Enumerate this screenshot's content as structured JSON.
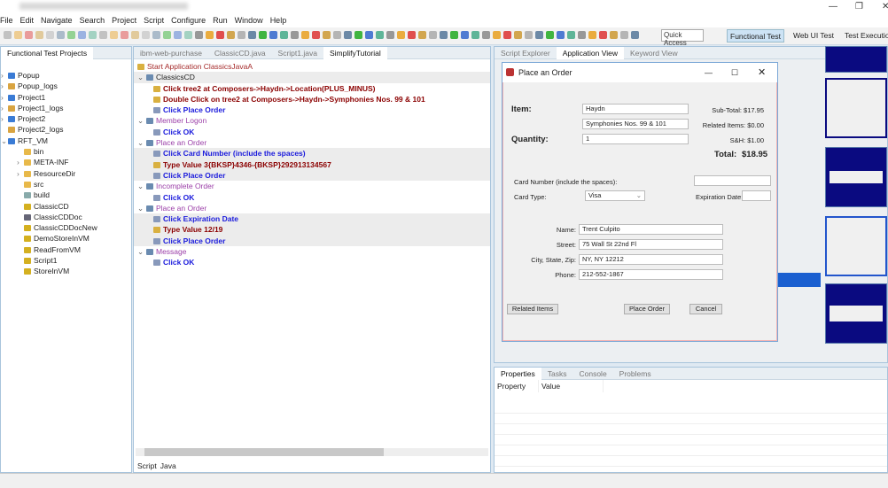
{
  "window": {
    "controls": [
      "—",
      "❐",
      "✕"
    ]
  },
  "menu": [
    "File",
    "Edit",
    "Navigate",
    "Search",
    "Project",
    "Script",
    "Configure",
    "Run",
    "Window",
    "Help"
  ],
  "toolbar": {
    "quick_access": "Quick Access",
    "perspectives": [
      "Functional Test",
      "Web UI Test",
      "Test Execution"
    ]
  },
  "projects": {
    "title": "Functional Test Projects",
    "items": [
      {
        "label": "Popup",
        "type": "project",
        "level": 0,
        "expander": "›"
      },
      {
        "label": "Popup_logs",
        "type": "logs",
        "level": 0,
        "expander": "›"
      },
      {
        "label": "Project1",
        "type": "project",
        "level": 0,
        "expander": "›"
      },
      {
        "label": "Project1_logs",
        "type": "logs",
        "level": 0,
        "expander": "›"
      },
      {
        "label": "Project2",
        "type": "project",
        "level": 0,
        "expander": "›"
      },
      {
        "label": "Project2_logs",
        "type": "logs",
        "level": 0,
        "expander": ""
      },
      {
        "label": "RFT_VM",
        "type": "project",
        "level": 0,
        "expander": "⌄"
      },
      {
        "label": "bin",
        "type": "folder",
        "level": 1,
        "expander": ""
      },
      {
        "label": "META-INF",
        "type": "folder",
        "level": 1,
        "expander": "›"
      },
      {
        "label": "ResourceDir",
        "type": "folder",
        "level": 1,
        "expander": "›"
      },
      {
        "label": "src",
        "type": "folder",
        "level": 1,
        "expander": ""
      },
      {
        "label": "build",
        "type": "file",
        "level": 1,
        "expander": ""
      },
      {
        "label": "ClassicCD",
        "type": "script",
        "level": 1,
        "expander": ""
      },
      {
        "label": "ClassicCDDoc",
        "type": "doc",
        "level": 1,
        "expander": ""
      },
      {
        "label": "ClassicCDDocNew",
        "type": "script",
        "level": 1,
        "expander": ""
      },
      {
        "label": "DemoStoreInVM",
        "type": "script",
        "level": 1,
        "expander": ""
      },
      {
        "label": "ReadFromVM",
        "type": "script",
        "level": 1,
        "expander": ""
      },
      {
        "label": "Script1",
        "type": "script",
        "level": 1,
        "expander": ""
      },
      {
        "label": "StoreInVM",
        "type": "script",
        "level": 1,
        "expander": ""
      }
    ]
  },
  "editor": {
    "tabs": [
      "ibm-web-purchase",
      "ClassicCD.java",
      "Script1.java",
      "SimplifyTutorial"
    ],
    "active_tab": 3,
    "steps": [
      {
        "text": "Start  Application  ClassicsJavaA",
        "style": "start",
        "level": 0,
        "hl": false
      },
      {
        "text": "ClassicsCD",
        "style": "group",
        "level": 0,
        "hl": true
      },
      {
        "text": "Click  tree2  at  Composers->Haydn->Location(PLUS_MINUS)",
        "style": "red",
        "level": 1,
        "hl": false
      },
      {
        "text": "Double  Click  on  tree2  at  Composers->Haydn->Symphonies Nos. 99 & 101",
        "style": "red",
        "level": 1,
        "hl": false
      },
      {
        "text": "Click  Place Order",
        "style": "blue",
        "level": 1,
        "hl": false
      },
      {
        "text": "Member Logon",
        "style": "purple",
        "level": 0,
        "hl": false
      },
      {
        "text": "Click  OK",
        "style": "blue",
        "level": 1,
        "hl": false
      },
      {
        "text": "Place an Order",
        "style": "purple",
        "level": 0,
        "hl": false
      },
      {
        "text": "Click  Card Number (include the spaces)",
        "style": "blue",
        "level": 1,
        "hl": true
      },
      {
        "text": "Type  Value  3{BKSP}4346-{BKSP}292913134567",
        "style": "red",
        "level": 1,
        "hl": true
      },
      {
        "text": "Click  Place Order",
        "style": "blue",
        "level": 1,
        "hl": true
      },
      {
        "text": "Incomplete Order",
        "style": "purple",
        "level": 0,
        "hl": false
      },
      {
        "text": "Click  OK",
        "style": "blue",
        "level": 1,
        "hl": false
      },
      {
        "text": "Place an Order",
        "style": "purple",
        "level": 0,
        "hl": false
      },
      {
        "text": "Click  Expiration Date",
        "style": "blue",
        "level": 1,
        "hl": true
      },
      {
        "text": "Type  Value  12/19",
        "style": "red",
        "level": 1,
        "hl": true
      },
      {
        "text": "Click  Place Order",
        "style": "blue",
        "level": 1,
        "hl": true
      },
      {
        "text": "Message",
        "style": "purple",
        "level": 0,
        "hl": false
      },
      {
        "text": "Click  OK",
        "style": "blue",
        "level": 1,
        "hl": false
      }
    ],
    "bottom_tabs": [
      "Script",
      "Java"
    ]
  },
  "right_tabs": {
    "tabs": [
      "Script Explorer",
      "Application View",
      "Keyword View"
    ],
    "active_tab": 1
  },
  "dialog": {
    "title": "Place an Order",
    "item_label": "Item:",
    "item1": "Haydn",
    "item2": "Symphonies Nos. 99 & 101",
    "quantity_label": "Quantity:",
    "quantity": "1",
    "subtotal": "Sub-Total: $17.95",
    "related": "Related Items: $0.00",
    "sh": "S&H: $1.00",
    "total_label": "Total:",
    "total": "$18.95",
    "card_number_label": "Card Number (include the spaces):",
    "card_number": "",
    "card_type_label": "Card Type:",
    "card_type": "Visa",
    "exp_label": "Expiration Date:",
    "exp": "",
    "name_label": "Name:",
    "name": "Trent Culpito",
    "street_label": "Street:",
    "street": "75 Wall St 22nd Fl",
    "city_label": "City, State, Zip:",
    "city": "NY, NY 12212",
    "phone_label": "Phone:",
    "phone": "212-552-1867",
    "buttons": {
      "related": "Related Items",
      "place": "Place Order",
      "cancel": "Cancel"
    }
  },
  "properties": {
    "tabs": [
      "Properties",
      "Tasks",
      "Console",
      "Problems"
    ],
    "columns": [
      "Property",
      "Value"
    ]
  }
}
